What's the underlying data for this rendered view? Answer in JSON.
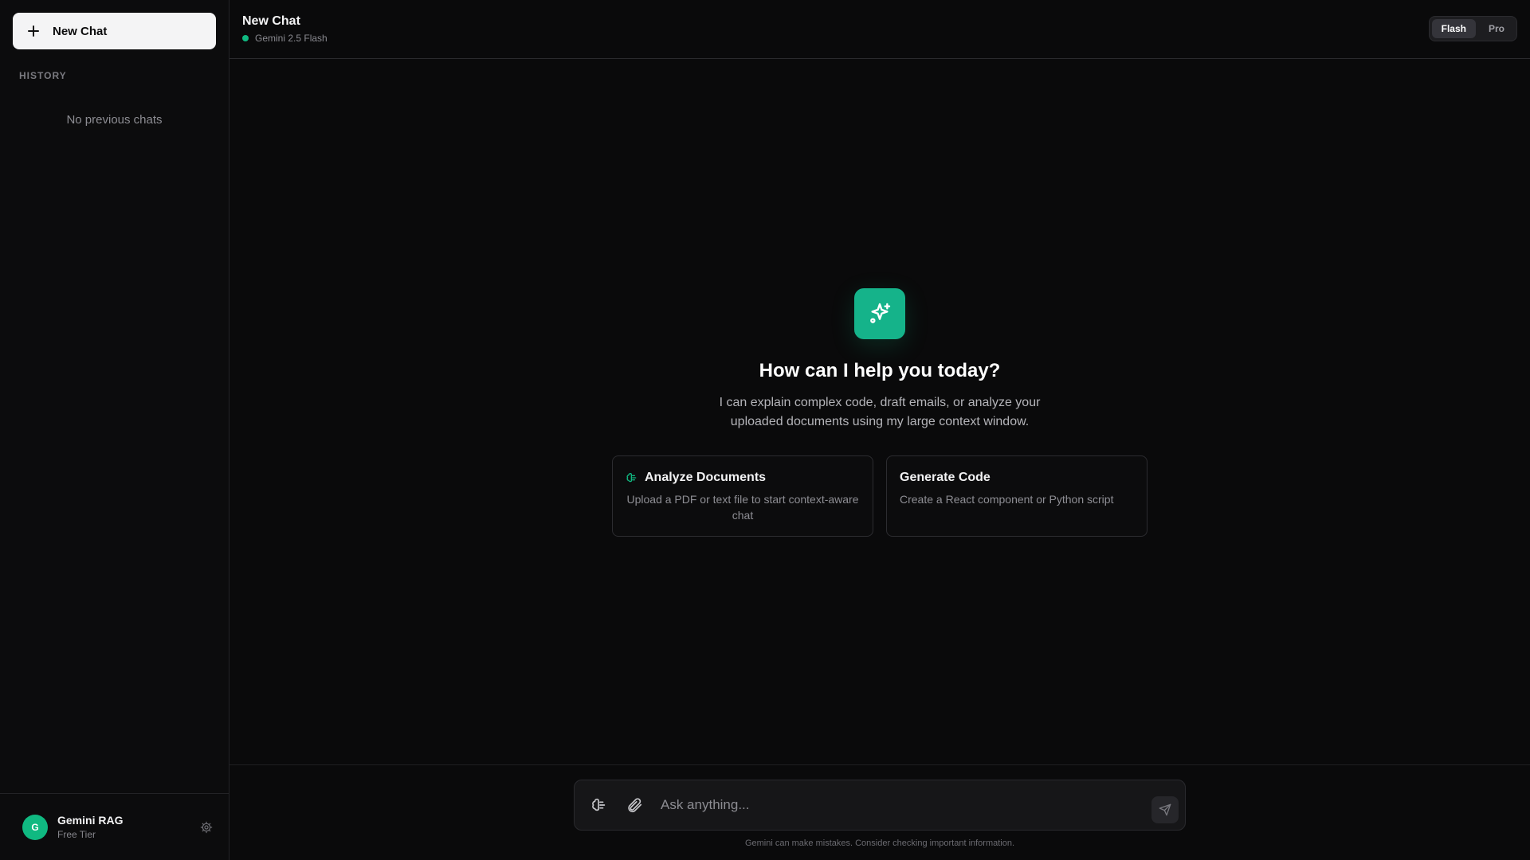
{
  "sidebar": {
    "new_chat_label": "New Chat",
    "history_label": "HISTORY",
    "empty_history": "No previous chats",
    "user": {
      "initial": "G",
      "name": "Gemini RAG",
      "tier": "Free Tier"
    }
  },
  "header": {
    "title": "New Chat",
    "model": "Gemini 2.5 Flash",
    "model_options": [
      "Flash",
      "Pro"
    ],
    "selected_model": "Flash"
  },
  "hero": {
    "title": "How can I help you today?",
    "subtitle": "I can explain complex code, draft emails, or analyze your uploaded documents using my large context window."
  },
  "cards": [
    {
      "title": "Analyze Documents",
      "desc": "Upload a PDF or text file to start context-aware chat",
      "icon": "brain-icon"
    },
    {
      "title": "Generate Code",
      "desc": "Create a React component or Python script"
    }
  ],
  "composer": {
    "placeholder": "Ask anything...",
    "disclaimer": "Gemini can make mistakes. Consider checking important information."
  },
  "colors": {
    "accent": "#10b981",
    "background": "#0a0a0b",
    "sidebar": "#0c0c0d"
  }
}
